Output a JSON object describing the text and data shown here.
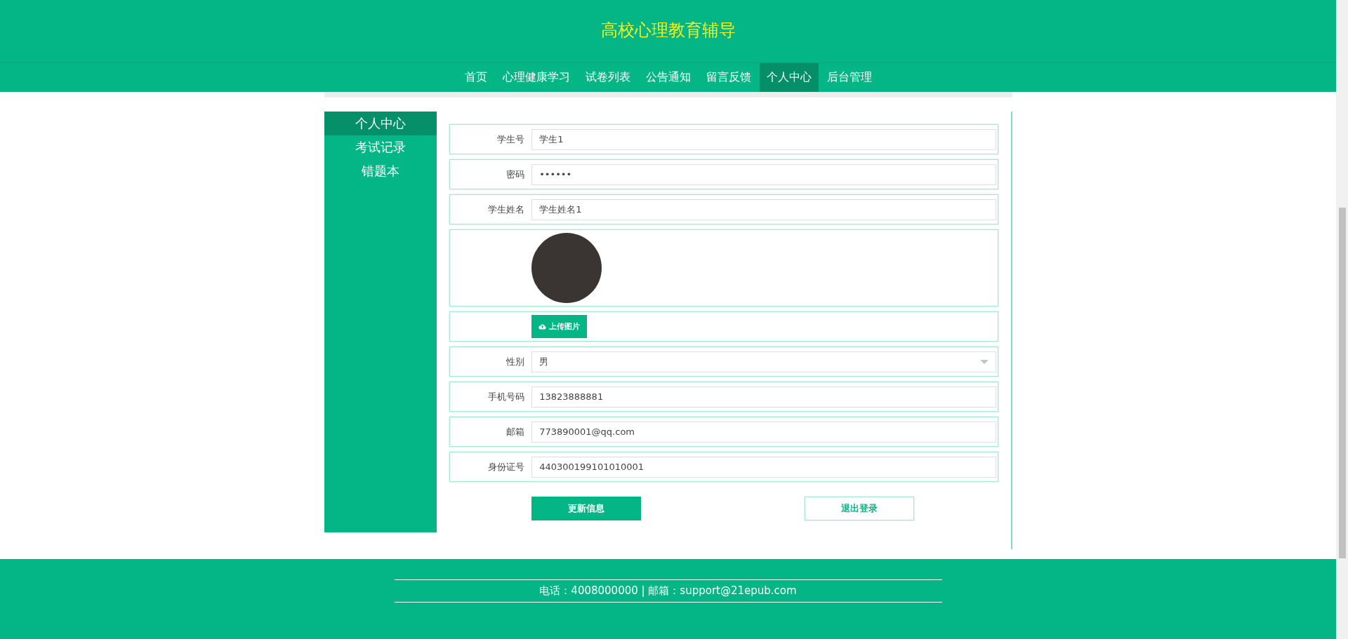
{
  "site_title": "高校心理教育辅导",
  "nav": [
    {
      "label": "首页",
      "selected": false
    },
    {
      "label": "心理健康学习",
      "selected": false
    },
    {
      "label": "试卷列表",
      "selected": false
    },
    {
      "label": "公告通知",
      "selected": false
    },
    {
      "label": "留言反馈",
      "selected": false
    },
    {
      "label": "个人中心",
      "selected": true
    },
    {
      "label": "后台管理",
      "selected": false
    }
  ],
  "sidebar": {
    "items": [
      {
        "label": "个人中心",
        "selected": true
      },
      {
        "label": "考试记录",
        "selected": false
      },
      {
        "label": "错题本",
        "selected": false
      }
    ]
  },
  "form": {
    "fields": [
      {
        "kind": "text",
        "label": "学生号",
        "value": "学生1"
      },
      {
        "kind": "text",
        "label": "密码",
        "value": "••••••"
      },
      {
        "kind": "text",
        "label": "学生姓名",
        "value": "学生姓名1"
      },
      {
        "kind": "avatar"
      },
      {
        "kind": "upload",
        "button": "上传图片"
      },
      {
        "kind": "select",
        "label": "性别",
        "value": "男"
      },
      {
        "kind": "text",
        "label": "手机号码",
        "value": "13823888881"
      },
      {
        "kind": "text",
        "label": "邮箱",
        "value": "773890001@qq.com"
      },
      {
        "kind": "text",
        "label": "身份证号",
        "value": "440300199101010001"
      }
    ],
    "buttons": [
      {
        "kind": "primary",
        "label": "更新信息"
      },
      {
        "kind": "outline",
        "label": "退出登录"
      }
    ]
  },
  "footer": {
    "text": "电话：4008000000 | 邮箱：support@21epub.com"
  }
}
